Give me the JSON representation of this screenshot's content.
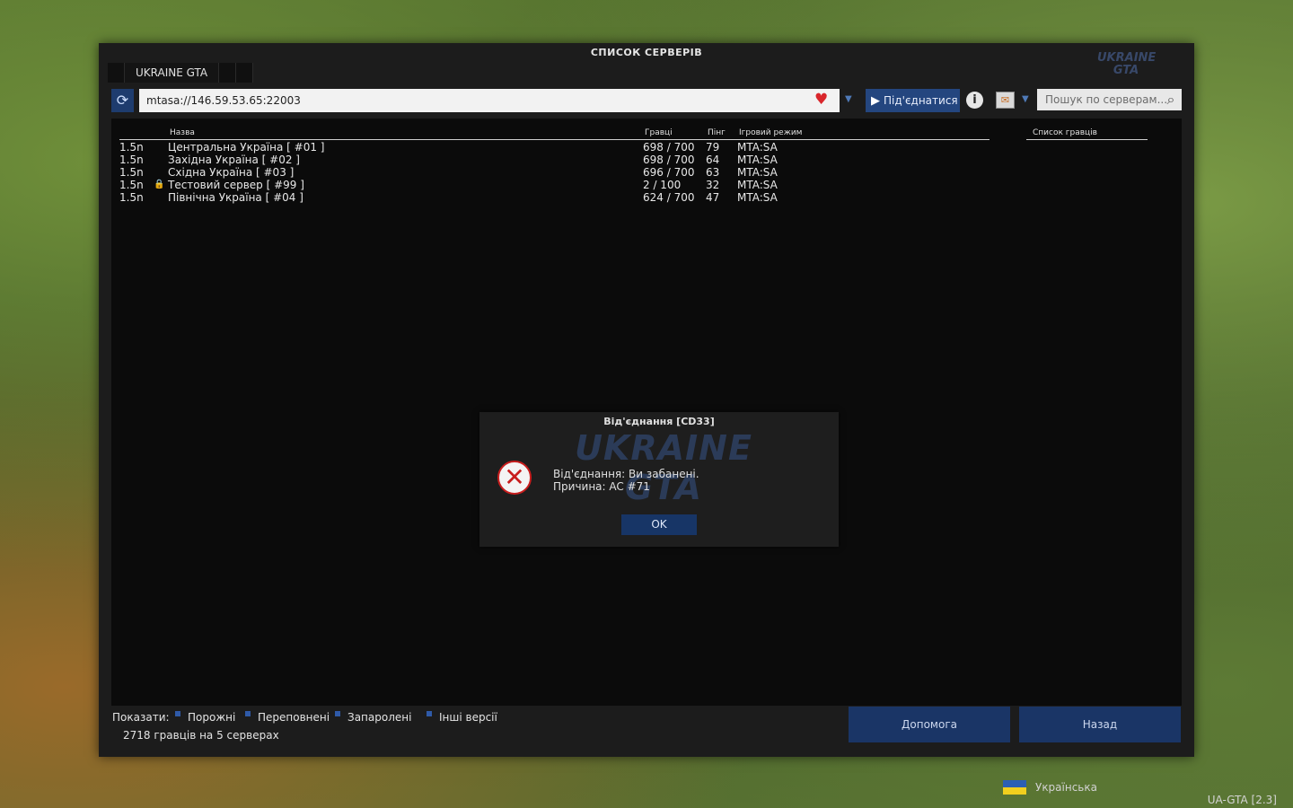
{
  "window": {
    "title": "СПИСОК СЕРВЕРІВ",
    "tab_label": "UKRAINE GTA"
  },
  "toolbar": {
    "address_value": "mtasa://146.59.53.65:22003",
    "connect_label": "Під'єднатися",
    "search_placeholder": "Пошук по серверам...",
    "icons": {
      "refresh": "refresh-icon",
      "favorite": "heart-icon",
      "info": "info-icon",
      "mail": "mail-icon",
      "search": "search-icon"
    }
  },
  "list": {
    "headers": {
      "name": "Назва",
      "players": "Гравці",
      "ping": "Пінг",
      "mode": "Ігровий режим"
    },
    "players_list_title": "Список гравців",
    "rows": [
      {
        "version": "1.5n",
        "locked": false,
        "name": "Центральна Україна [ #01 ]",
        "players": "698 / 700",
        "ping": "79",
        "mode": "MTA:SA"
      },
      {
        "version": "1.5n",
        "locked": false,
        "name": "Західна Україна [ #02 ]",
        "players": "698 / 700",
        "ping": "64",
        "mode": "MTA:SA"
      },
      {
        "version": "1.5n",
        "locked": false,
        "name": "Східна Україна [ #03 ]",
        "players": "696 / 700",
        "ping": "63",
        "mode": "MTA:SA"
      },
      {
        "version": "1.5n",
        "locked": true,
        "name": "Тестовий сервер [ #99 ]",
        "players": "2 / 100",
        "ping": "32",
        "mode": "MTA:SA"
      },
      {
        "version": "1.5n",
        "locked": false,
        "name": "Північна Україна [ #04 ]",
        "players": "624 / 700",
        "ping": "47",
        "mode": "MTA:SA"
      }
    ]
  },
  "dialog": {
    "title": "Від'єднання [CD33]",
    "message_line1": "Від'єднання: Ви забанені.",
    "message_line2": "Причина: AC #71",
    "ok_label": "OK"
  },
  "filters": {
    "label": "Показати:",
    "options": [
      "Порожні",
      "Переповнені",
      "Запаролені",
      "Інші версії"
    ]
  },
  "status": "2718 гравців на 5 серверах",
  "buttons": {
    "help_label": "Допомога",
    "back_label": "Назад"
  },
  "language": "Українська",
  "version": "UA-GTA [2.3]",
  "colors": {
    "accent_blue": "#24467f",
    "favorite_red": "#d9262b",
    "error_red": "#c81d1d"
  }
}
